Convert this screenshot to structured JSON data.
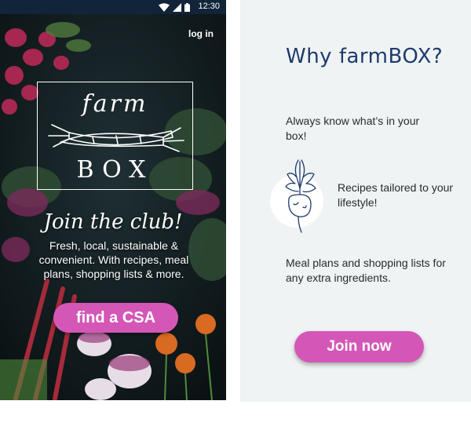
{
  "status_bar": {
    "time": "12:30",
    "icons": [
      "wifi-icon",
      "signal-icon",
      "battery-icon"
    ]
  },
  "landing": {
    "login_label": "log in",
    "logo": {
      "top_word": "farm",
      "bottom_word": "BOX"
    },
    "headline": "Join the club!",
    "tagline": "Fresh, local, sustainable & convenient. With recipes, meal plans, shopping lists & more.",
    "cta_label": "find a CSA"
  },
  "why_screen": {
    "title": "Why farmBOX?",
    "features": [
      {
        "text": "Always know what’s in your box!"
      },
      {
        "text": "Recipes tailored to your lifestyle!",
        "icon": "beet-icon"
      },
      {
        "text": "Meal plans and shopping lists for any extra ingredients."
      }
    ],
    "join_label": "Join now"
  },
  "colors": {
    "accent": "#d457b7",
    "title_blue": "#1f3b6e",
    "panel_bg": "#eff3f3",
    "statusbar": "#12243a"
  }
}
